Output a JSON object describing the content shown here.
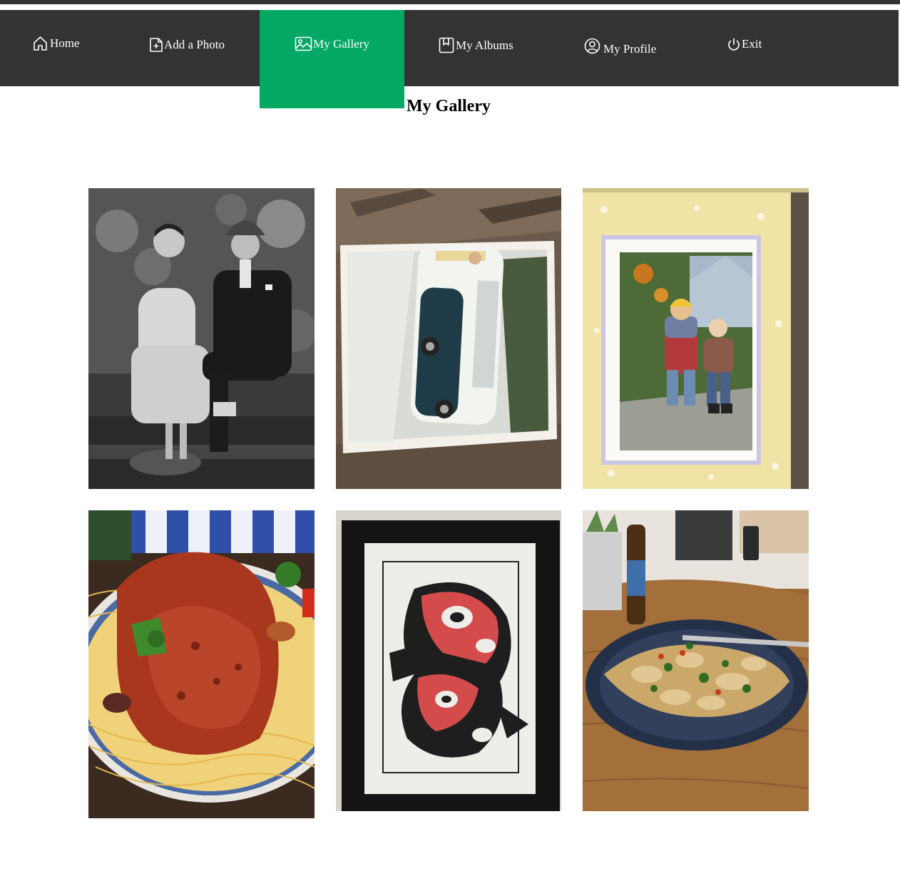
{
  "nav": {
    "items": [
      {
        "label": "Home",
        "icon": "home-icon"
      },
      {
        "label": "Add a Photo",
        "icon": "add-file-icon"
      },
      {
        "label": "My Gallery",
        "icon": "image-icon",
        "active": true
      },
      {
        "label": "My Albums",
        "icon": "bookmark-album-icon"
      },
      {
        "label": "My Profile",
        "icon": "user-circle-icon"
      },
      {
        "label": "Exit",
        "icon": "power-icon"
      }
    ],
    "colors": {
      "bar": "#333333",
      "active": "#04a865",
      "text": "#ffffff"
    }
  },
  "page": {
    "title": "My Gallery"
  },
  "gallery": {
    "photos": [
      {
        "subject": "vintage black and white couple portrait"
      },
      {
        "subject": "photo of a van on a wooden table"
      },
      {
        "subject": "framed photo of two children"
      },
      {
        "subject": "chicken with tomato sauce on spaghetti"
      },
      {
        "subject": "framed formline art print"
      },
      {
        "subject": "plate of chicken pasta on wooden table"
      }
    ]
  }
}
